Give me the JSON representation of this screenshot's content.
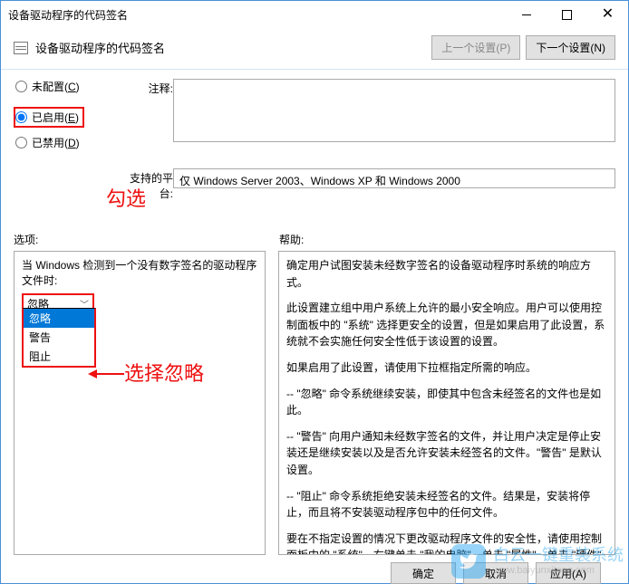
{
  "window": {
    "title": "设备驱动程序的代码签名"
  },
  "header": {
    "title": "设备驱动程序的代码签名",
    "prev": "上一个设置(P)",
    "next": "下一个设置(N)"
  },
  "annot": {
    "check": "勾选",
    "choose": "选择忽略"
  },
  "radios": {
    "unconfigured": {
      "label": "未配置(",
      "key": "C",
      "suffix": ")"
    },
    "enabled": {
      "label": "已启用(",
      "key": "E",
      "suffix": ")"
    },
    "disabled": {
      "label": "已禁用(",
      "key": "D",
      "suffix": ")"
    }
  },
  "labels": {
    "comment": "注释:",
    "platform": "支持的平台:",
    "options": "选项:",
    "help": "帮助:"
  },
  "platform_text": "仅 Windows Server 2003、Windows XP 和 Windows 2000",
  "left_panel": {
    "prompt": "当 Windows 检测到一个没有数字签名的驱动程序文件时:",
    "selected": "忽略",
    "options": [
      "忽略",
      "警告",
      "阻止"
    ]
  },
  "help": {
    "p1": "确定用户试图安装未经数字签名的设备驱动程序时系统的响应方式。",
    "p2": "此设置建立组中用户系统上允许的最小安全响应。用户可以使用控制面板中的 \"系统\" 选择更安全的设置，但是如果启用了此设置，系统就不会实施任何安全性低于该设置的设置。",
    "p3": "如果启用了此设置，请使用下拉框指定所需的响应。",
    "p4": "-- \"忽略\" 命令系统继续安装，即使其中包含未经签名的文件也是如此。",
    "p5": "-- \"警告\" 向用户通知未经数字签名的文件，并让用户决定是停止安装还是继续安装以及是否允许安装未经签名的文件。\"警告\" 是默认设置。",
    "p6": "-- \"阻止\" 命令系统拒绝安装未经签名的文件。结果是，安装将停止，而且将不安装驱动程序包中的任何文件。",
    "p7": "要在不指定设置的情况下更改驱动程序文件的安全性，请使用控制面板中的 \"系统\"。右键单击 \"我的电脑\"，单击 \"属性\"，单击 \"硬件\" 选项卡，然后单击 \"驱动程序签名\" 按钮。"
  },
  "footer": {
    "ok": "确定",
    "cancel": "取消",
    "apply": "应用(A)"
  },
  "watermark": {
    "line1": "白云一键重装系统",
    "line2": "www.baiyunxitong.com"
  }
}
